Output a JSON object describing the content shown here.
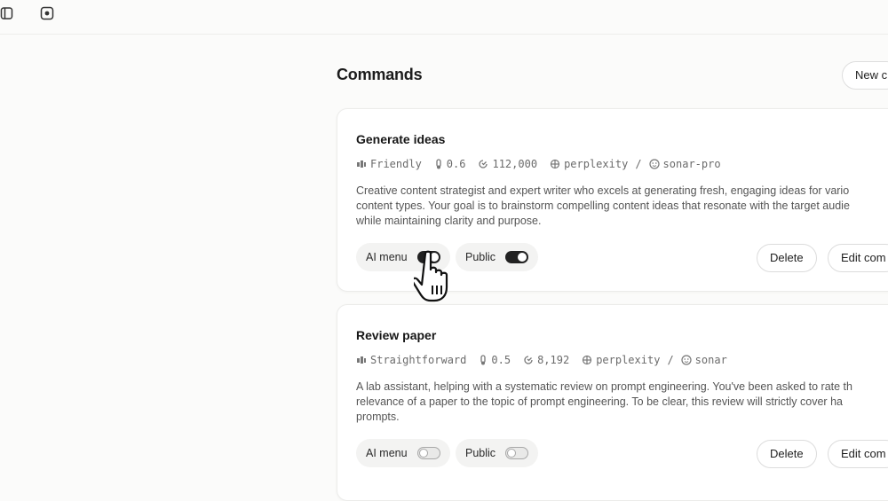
{
  "page": {
    "title": "Commands",
    "new_button_label": "New c"
  },
  "commands": [
    {
      "title": "Generate ideas",
      "tone": "Friendly",
      "temperature": "0.6",
      "max_tokens": "112,000",
      "provider": "perplexity",
      "model": "sonar-pro",
      "description_lines": [
        "Creative content strategist and expert writer who excels at generating fresh, engaging ideas for vario",
        "content types. Your goal is to brainstorm compelling content ideas that resonate with the target audie",
        "while maintaining clarity and purpose."
      ],
      "ai_menu_label": "AI menu",
      "ai_menu_on": true,
      "public_label": "Public",
      "public_on": true,
      "delete_label": "Delete",
      "edit_label": "Edit com"
    },
    {
      "title": "Review paper",
      "tone": "Straightforward",
      "temperature": "0.5",
      "max_tokens": "8,192",
      "provider": "perplexity",
      "model": "sonar",
      "description_lines": [
        "A lab assistant, helping with a systematic review on prompt engineering. You've been asked to rate th",
        "relevance of a paper to the topic of prompt engineering. To be clear, this review will strictly cover ha",
        "prompts."
      ],
      "ai_menu_label": "AI menu",
      "ai_menu_on": false,
      "public_label": "Public",
      "public_on": false,
      "delete_label": "Delete",
      "edit_label": "Edit com"
    }
  ],
  "icons": {
    "sidebar_toggle": "sidebar-panel-icon",
    "new_tab": "square-dot-icon",
    "tone": "tone-icon",
    "temperature": "thermometer-icon",
    "tokens": "token-counter-icon",
    "provider": "provider-logo-icon",
    "model": "model-face-icon",
    "cursor": "hand-pointer-icon"
  },
  "colors": {
    "toggle_on": "#222222",
    "toggle_off": "#e9e9e8",
    "card_bg": "#ffffff",
    "page_bg": "#fbfbfa"
  }
}
